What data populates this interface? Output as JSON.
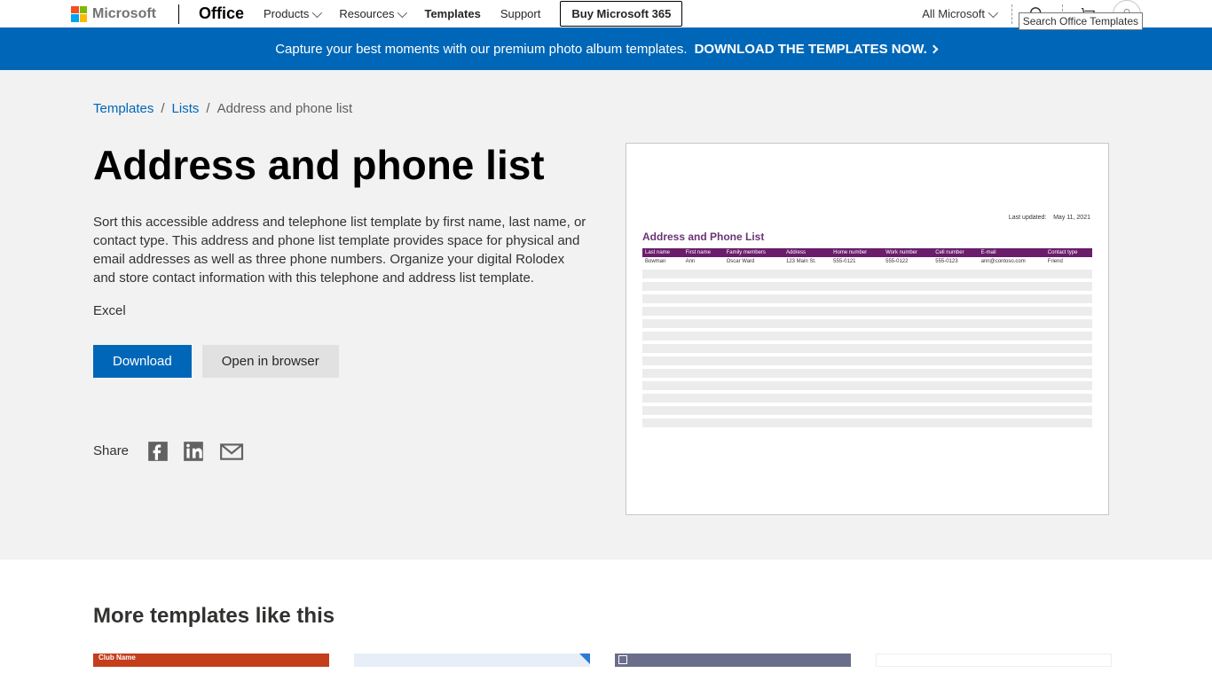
{
  "header": {
    "brand": "Microsoft",
    "office": "Office",
    "nav": {
      "products": "Products",
      "resources": "Resources",
      "templates": "Templates",
      "support": "Support",
      "buy": "Buy Microsoft 365"
    },
    "all_ms": "All Microsoft",
    "search_tooltip": "Search Office Templates"
  },
  "banner": {
    "text": "Capture your best moments with our premium photo album templates.",
    "cta": "DOWNLOAD THE TEMPLATES NOW."
  },
  "breadcrumb": {
    "root": "Templates",
    "mid": "Lists",
    "current": "Address and phone list"
  },
  "page": {
    "title": "Address and phone list",
    "description": "Sort this accessible address and telephone list template by first name, last name, or contact type. This address and phone list template provides space for physical and email addresses as well as three phone numbers. Organize your digital Rolodex and store contact information with this telephone and address list template.",
    "app": "Excel",
    "download": "Download",
    "open": "Open in browser",
    "share": "Share"
  },
  "preview": {
    "last_updated_label": "Last updated:",
    "last_updated_value": "May 11, 2021",
    "title": "Address and Phone List",
    "columns": [
      "Last name",
      "First name",
      "Family members",
      "Address",
      "Home number",
      "Work number",
      "Cell number",
      "E-mail",
      "Contact type"
    ],
    "row": {
      "last": "Bowman",
      "first": "Ann",
      "fam": "Oscar Ward",
      "addr": "123 Main St.",
      "home": "555-0121",
      "work": "555-0122",
      "cell": "555-0123",
      "email": "ann@contoso.com",
      "type": "Friend"
    }
  },
  "more": {
    "title": "More templates like this",
    "card1_label": "Club Name"
  }
}
